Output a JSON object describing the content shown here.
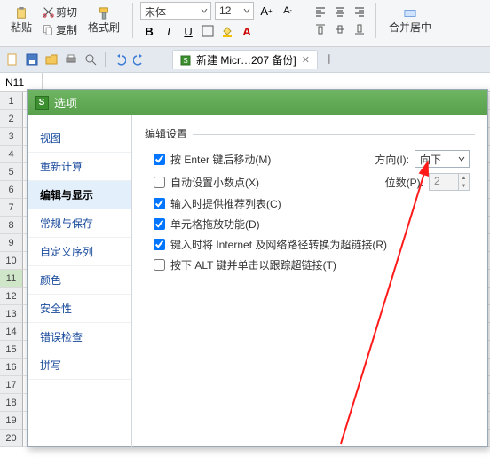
{
  "ribbon": {
    "paste_label": "粘贴",
    "cut_label": "剪切",
    "copy_label": "复制",
    "format_painter_label": "格式刷",
    "font_family": "宋体",
    "font_size": "12",
    "align_group": "合并居中"
  },
  "qab": {
    "tab_label": "新建 Micr…207 备份]"
  },
  "cellbar": {
    "name": "N11"
  },
  "dialog": {
    "title": "选项",
    "nav": {
      "items": [
        {
          "label": "视图"
        },
        {
          "label": "重新计算"
        },
        {
          "label": "编辑与显示"
        },
        {
          "label": "常规与保存"
        },
        {
          "label": "自定义序列"
        },
        {
          "label": "颜色"
        },
        {
          "label": "安全性"
        },
        {
          "label": "错误检查"
        },
        {
          "label": "拼写"
        }
      ]
    },
    "pane": {
      "group_label": "编辑设置",
      "opt_enter": "按 Enter 键后移动(M)",
      "dir_label": "方向(I):",
      "dir_value": "向下",
      "opt_auto_decimal": "自动设置小数点(X)",
      "places_label": "位数(P):",
      "places_value": "2",
      "opt_suggest_list": "输入时提供推荐列表(C)",
      "opt_cell_drag": "单元格拖放功能(D)",
      "opt_internet_hyperlink": "键入时将 Internet 及网络路径转换为超链接(R)",
      "opt_alt_click": "按下 ALT 键并单击以跟踪超链接(T)"
    }
  },
  "rows": [
    "1",
    "2",
    "3",
    "4",
    "5",
    "6",
    "7",
    "8",
    "9",
    "10",
    "11",
    "12",
    "13",
    "14",
    "15",
    "16",
    "17",
    "18",
    "19",
    "20"
  ]
}
